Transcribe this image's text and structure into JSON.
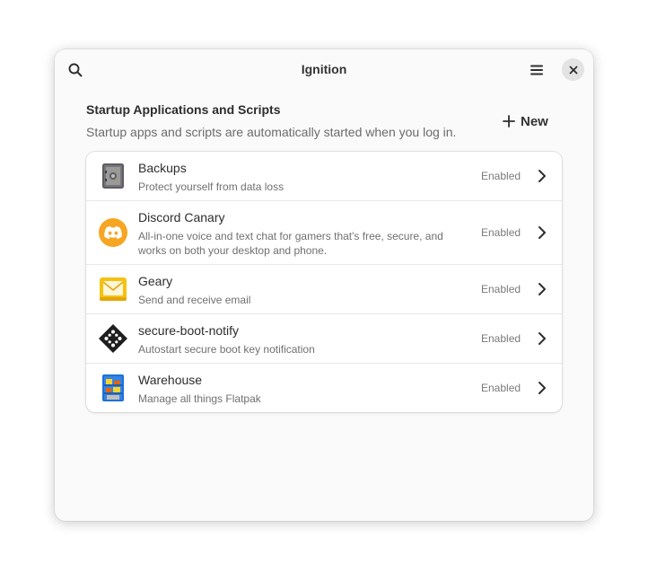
{
  "window": {
    "title": "Ignition",
    "icons": {
      "search": "search-icon",
      "menu": "hamburger-menu-icon",
      "close": "close-icon"
    }
  },
  "group": {
    "title": "Startup Applications and Scripts",
    "description": "Startup apps and scripts are automatically started when you log in.",
    "new_label": "New"
  },
  "apps": [
    {
      "name": "Backups",
      "description": "Protect yourself from data loss",
      "status": "Enabled",
      "icon": "safe-icon"
    },
    {
      "name": "Discord Canary",
      "description": "All-in-one voice and text chat for gamers that's free, secure, and works on both your desktop and phone.",
      "status": "Enabled",
      "icon": "discord-icon"
    },
    {
      "name": "Geary",
      "description": "Send and receive email",
      "status": "Enabled",
      "icon": "mail-envelope-icon"
    },
    {
      "name": "secure-boot-notify",
      "description": "Autostart secure boot key notification",
      "status": "Enabled",
      "icon": "secure-boot-icon"
    },
    {
      "name": "Warehouse",
      "description": "Manage all things Flatpak",
      "status": "Enabled",
      "icon": "warehouse-shelves-icon"
    }
  ],
  "colors": {
    "discord": "#f6a623",
    "geary": "#f5c211",
    "warehouse": "#3584e4"
  }
}
